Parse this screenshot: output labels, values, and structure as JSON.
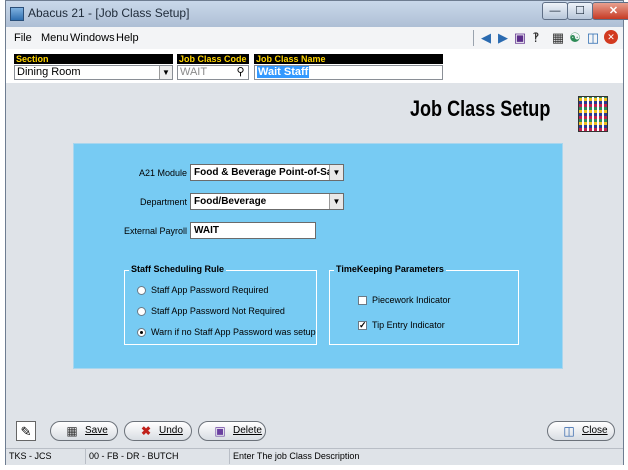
{
  "window": {
    "title": "Abacus 21 - [Job Class Setup]"
  },
  "menu": {
    "items": [
      "File",
      "Menu",
      "Windows",
      "Help"
    ]
  },
  "toolbar": {
    "icons": [
      "arrow-left-icon",
      "arrow-right-icon",
      "book-icon",
      "question-icon",
      "calculator-icon",
      "exit-person-icon",
      "door-exit-icon",
      "close-red-icon"
    ]
  },
  "header": {
    "section_label": "Section",
    "section_value": "Dining Room",
    "code_label": "Job Class Code",
    "code_value": "WAIT",
    "name_label": "Job Class Name",
    "name_value": "Wait Staff"
  },
  "page": {
    "heading": "Job Class Setup"
  },
  "form": {
    "module_label": "A21 Module",
    "module_value": "Food & Beverage Point-of-Sale",
    "department_label": "Department",
    "department_value": "Food/Beverage",
    "payroll_label": "External Payroll",
    "payroll_value": "WAIT"
  },
  "scheduling": {
    "title": "Staff Scheduling Rule",
    "options": [
      {
        "label": "Staff App Password Required",
        "selected": false
      },
      {
        "label": "Staff App Password Not Required",
        "selected": false
      },
      {
        "label": "Warn if no Staff App Password was setup",
        "selected": true
      }
    ]
  },
  "timekeeping": {
    "title": "TimeKeeping Parameters",
    "options": [
      {
        "label": "Piecework Indicator",
        "checked": false
      },
      {
        "label": "Tip Entry Indicator",
        "checked": true
      }
    ]
  },
  "buttons": {
    "save": "Save",
    "undo": "Undo",
    "delete": "Delete",
    "close": "Close"
  },
  "status": {
    "seg1": "TKS - JCS",
    "seg2": "00 - FB - DR - BUTCH",
    "seg3": "Enter The job Class Description"
  },
  "colors": {
    "panel": "#77cbf3",
    "header_label_bg": "#000000",
    "header_label_text": "#ffd400",
    "selection": "#3399ff"
  }
}
